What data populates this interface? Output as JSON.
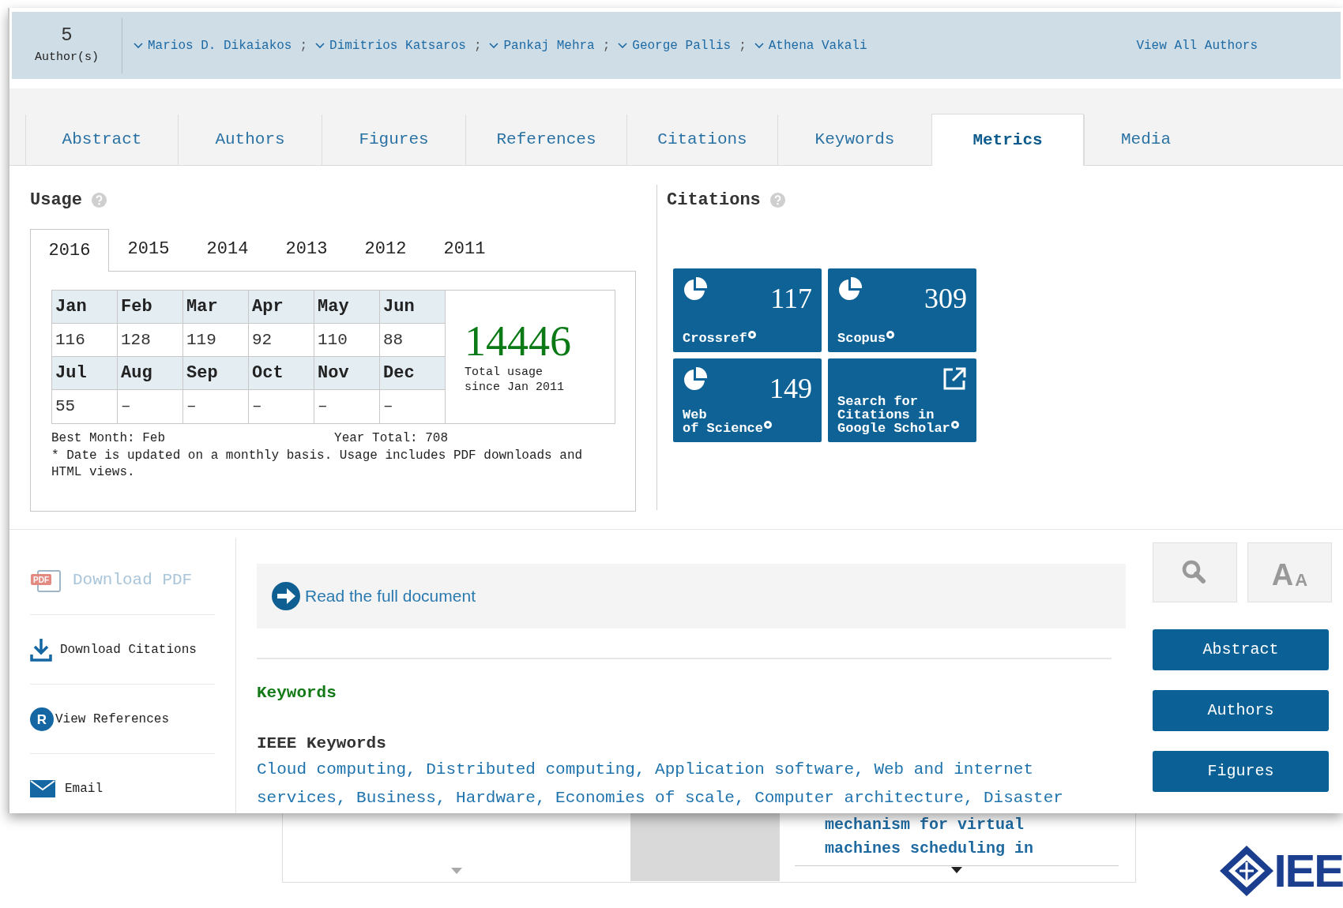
{
  "authors_bar": {
    "count": "5",
    "count_label": "Author(s)",
    "authors": [
      {
        "name": "Marios D. Dikaiakos",
        "separator": ";"
      },
      {
        "name": "Dimitrios Katsaros",
        "separator": ";"
      },
      {
        "name": "Pankaj Mehra",
        "separator": ";"
      },
      {
        "name": "George Pallis",
        "separator": ";"
      },
      {
        "name": "Athena Vakali"
      }
    ],
    "view_all": "View All Authors"
  },
  "tabs": [
    {
      "label": "Abstract",
      "selected": false
    },
    {
      "label": "Authors",
      "selected": false
    },
    {
      "label": "Figures",
      "selected": false
    },
    {
      "label": "References",
      "selected": false
    },
    {
      "label": "Citations",
      "selected": false
    },
    {
      "label": "Keywords",
      "selected": false
    },
    {
      "label": "Metrics",
      "selected": true
    },
    {
      "label": "Media",
      "selected": false
    }
  ],
  "usage": {
    "title": "Usage",
    "year_tabs": [
      {
        "label": "2016",
        "selected": true
      },
      {
        "label": "2015",
        "selected": false
      },
      {
        "label": "2014",
        "selected": false
      },
      {
        "label": "2013",
        "selected": false
      },
      {
        "label": "2012",
        "selected": false
      },
      {
        "label": "2011",
        "selected": false
      }
    ],
    "months": [
      {
        "month": "Jan",
        "value": "116"
      },
      {
        "month": "Feb",
        "value": "128"
      },
      {
        "month": "Mar",
        "value": "119"
      },
      {
        "month": "Apr",
        "value": "92"
      },
      {
        "month": "May",
        "value": "110"
      },
      {
        "month": "Jun",
        "value": "88"
      },
      {
        "month": "Jul",
        "value": "55"
      },
      {
        "month": "Aug",
        "value": "–"
      },
      {
        "month": "Sep",
        "value": "–"
      },
      {
        "month": "Oct",
        "value": "–"
      },
      {
        "month": "Nov",
        "value": "–"
      },
      {
        "month": "Dec",
        "value": "–"
      }
    ],
    "total": "14446",
    "total_caption": [
      "Total usage",
      "since Jan 2011"
    ],
    "best_month": "Best Month: Feb",
    "year_total": "Year Total: 708",
    "note": "* Date is updated on a monthly basis. Usage includes PDF downloads and HTML views."
  },
  "citations": {
    "title": "Citations",
    "tiles": [
      {
        "kind": "count",
        "count": "117",
        "source_lines": [
          "Crossref"
        ]
      },
      {
        "kind": "count",
        "count": "309",
        "source_lines": [
          "Scopus"
        ]
      },
      {
        "kind": "count",
        "count": "149",
        "source_lines": [
          "Web",
          "of Science"
        ]
      },
      {
        "kind": "link",
        "source_lines": [
          "Search for",
          "Citations in",
          "Google Scholar"
        ]
      }
    ]
  },
  "actions": [
    {
      "kind": "pdf",
      "label": "Download PDF",
      "icon_text": "PDF",
      "disabled": true
    },
    {
      "kind": "download",
      "label": "Download Citations",
      "disabled": false
    },
    {
      "kind": "references",
      "label": "View References",
      "icon_text": "R",
      "disabled": false
    },
    {
      "kind": "email",
      "label": "Email",
      "disabled": false
    }
  ],
  "read_full": "Read the full document",
  "keywords_title": "Keywords",
  "ieee_title": "IEEE Keywords",
  "ieee_keywords": [
    "Cloud computing,",
    "Distributed computing,",
    "Application software,",
    "Web and internet services,",
    "Business,",
    "Hardware,",
    "Economies of scale,",
    "Computer architecture,",
    "Disaster"
  ],
  "font_button": {
    "large": "A",
    "small": "A"
  },
  "nav_buttons": [
    "Abstract",
    "Authors",
    "Figures"
  ],
  "background_page": {
    "lines": [
      "mechanism for virtual",
      "machines scheduling in"
    ],
    "logo": "IEE"
  }
}
